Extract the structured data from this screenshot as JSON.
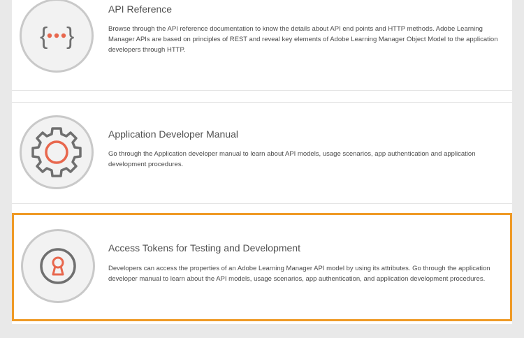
{
  "cards": [
    {
      "title": "API Reference",
      "description": "Browse through the API reference documentation to know the details about API end points and HTTP methods. Adobe Learning Manager APIs are based on principles of REST and reveal key elements of Adobe Learning Manager Object Model to the application developers through HTTP.",
      "icon": "braces-dots-icon"
    },
    {
      "title": "Application Developer Manual",
      "description": "Go through the Application developer manual to learn about API models, usage scenarios, app authentication and application development procedures.",
      "icon": "gear-icon"
    },
    {
      "title": "Access Tokens for Testing and Development",
      "description": "Developers can access the properties of an Adobe Learning Manager API model by using its attributes. Go through the application developer manual to learn about the API models, usage scenarios, app authentication, and application development procedures.",
      "icon": "keyhole-icon"
    }
  ],
  "colors": {
    "accent": "#e8674d",
    "icon_gray": "#6f6f6f",
    "highlight_border": "#ef9a26"
  }
}
